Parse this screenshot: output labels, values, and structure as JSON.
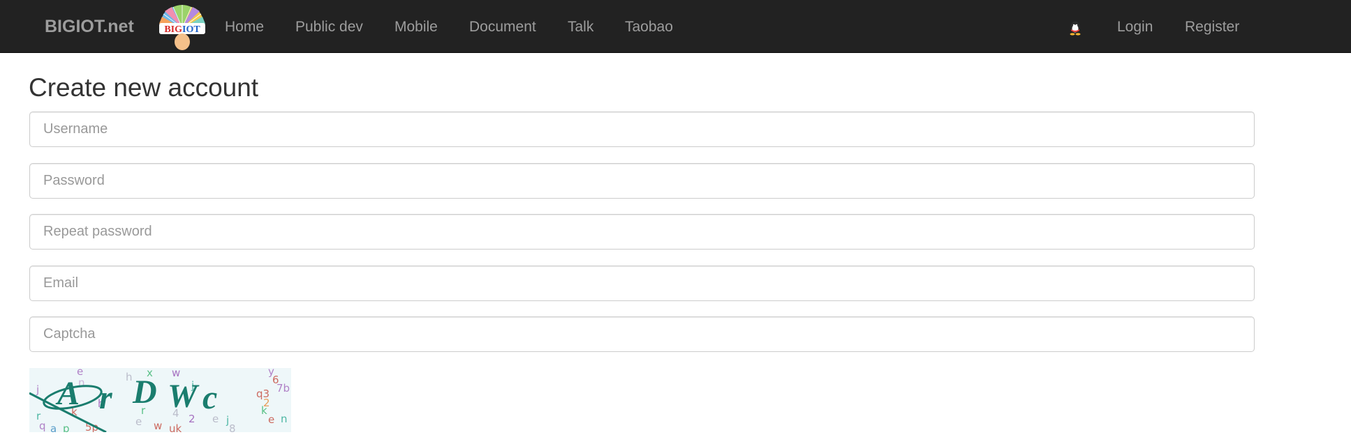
{
  "navbar": {
    "brand": "BIGIOT.net",
    "logo_text": "BIGIOT",
    "items": [
      {
        "label": "Home"
      },
      {
        "label": "Public dev"
      },
      {
        "label": "Mobile"
      },
      {
        "label": "Document"
      },
      {
        "label": "Talk"
      },
      {
        "label": "Taobao"
      }
    ],
    "right_items": [
      {
        "label": "Login"
      },
      {
        "label": "Register"
      }
    ],
    "qq_icon": "qq-penguin-icon"
  },
  "form": {
    "title": "Create new account",
    "fields": [
      {
        "placeholder": "Username",
        "value": ""
      },
      {
        "placeholder": "Password",
        "value": ""
      },
      {
        "placeholder": "Repeat password",
        "value": ""
      },
      {
        "placeholder": "Email",
        "value": ""
      },
      {
        "placeholder": "Captcha",
        "value": ""
      }
    ],
    "captcha_text": "ArDWc"
  },
  "colors": {
    "navbar_bg": "#222222",
    "nav_text": "#9d9d9d",
    "captcha_ink": "#1a7d6e"
  }
}
